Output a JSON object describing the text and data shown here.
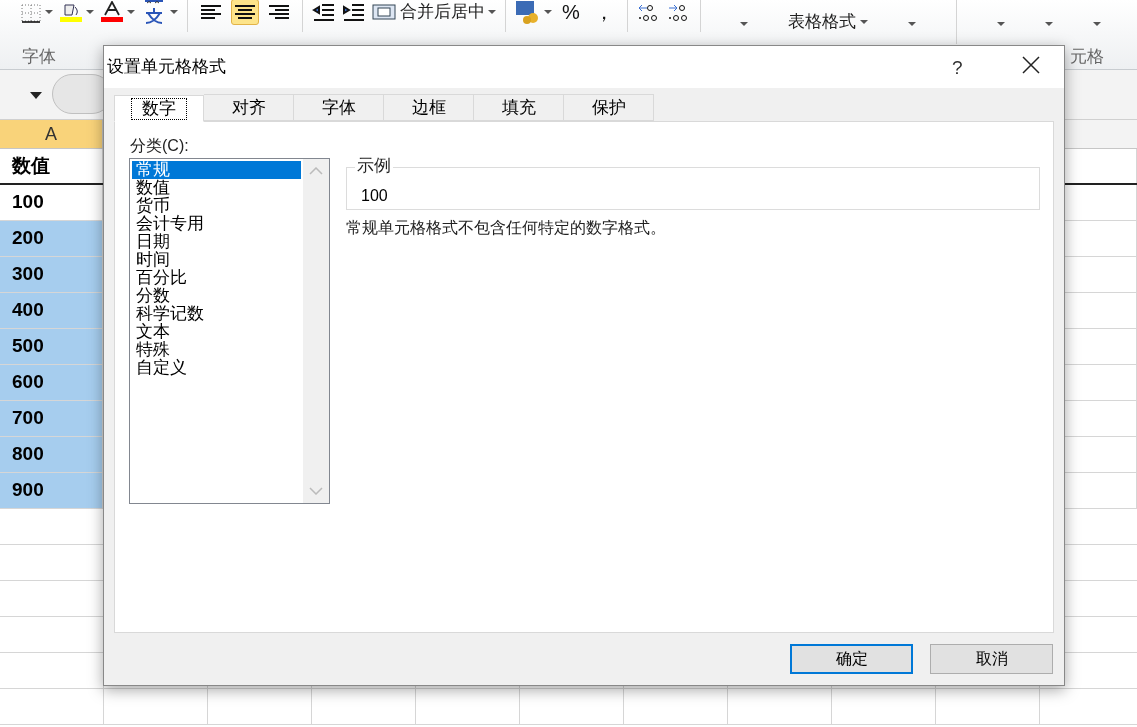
{
  "ribbon": {
    "tools": [
      {
        "kind": "borders"
      },
      {
        "kind": "fill"
      },
      {
        "kind": "fontcolor"
      },
      {
        "kind": "phonetic"
      },
      {
        "kind": "sep"
      },
      {
        "kind": "alignleft",
        "selected": false
      },
      {
        "kind": "aligncenter",
        "selected": true
      },
      {
        "kind": "alignright",
        "selected": false
      },
      {
        "kind": "sep"
      },
      {
        "kind": "outdent"
      },
      {
        "kind": "indent"
      },
      {
        "kind": "merge",
        "label": "合并后居中"
      },
      {
        "kind": "sep"
      },
      {
        "kind": "currency"
      },
      {
        "kind": "char",
        "label": "%"
      },
      {
        "kind": "char",
        "label": "，"
      },
      {
        "kind": "sep"
      },
      {
        "kind": "incdec"
      },
      {
        "kind": "decdec"
      },
      {
        "kind": "sep"
      }
    ],
    "big_buttons": [
      {
        "kind": "button"
      },
      {
        "kind": "button",
        "label": "表格格式"
      },
      {
        "kind": "button"
      },
      {
        "kind": "sep"
      },
      {
        "kind": "button"
      },
      {
        "kind": "button"
      },
      {
        "kind": "button"
      }
    ],
    "group_labels": [
      {
        "label": "字体"
      },
      {
        "label": "元格"
      }
    ]
  },
  "sheet": {
    "column_header": "A",
    "rows": [
      {
        "value": "数值",
        "kind": "header",
        "selected": false
      },
      {
        "value": "100",
        "kind": "cell",
        "selected": false
      },
      {
        "value": "200",
        "kind": "cell",
        "selected": true
      },
      {
        "value": "300",
        "kind": "cell",
        "selected": true
      },
      {
        "value": "400",
        "kind": "cell",
        "selected": true
      },
      {
        "value": "500",
        "kind": "cell",
        "selected": true
      },
      {
        "value": "600",
        "kind": "cell",
        "selected": true
      },
      {
        "value": "700",
        "kind": "cell",
        "selected": true
      },
      {
        "value": "800",
        "kind": "cell",
        "selected": true
      },
      {
        "value": "900",
        "kind": "cell",
        "selected": true
      }
    ]
  },
  "dialog": {
    "title": "设置单元格格式",
    "help": "?",
    "tabs": [
      {
        "label": "数字",
        "selected": true
      },
      {
        "label": "对齐",
        "selected": false
      },
      {
        "label": "字体",
        "selected": false
      },
      {
        "label": "边框",
        "selected": false
      },
      {
        "label": "填充",
        "selected": false
      },
      {
        "label": "保护",
        "selected": false
      }
    ],
    "category_label": "分类(C):",
    "categories": [
      {
        "label": "常规",
        "selected": true
      },
      {
        "label": "数值",
        "selected": false
      },
      {
        "label": "货币",
        "selected": false
      },
      {
        "label": "会计专用",
        "selected": false
      },
      {
        "label": "日期",
        "selected": false
      },
      {
        "label": "时间",
        "selected": false
      },
      {
        "label": "百分比",
        "selected": false
      },
      {
        "label": "分数",
        "selected": false
      },
      {
        "label": "科学记数",
        "selected": false
      },
      {
        "label": "文本",
        "selected": false
      },
      {
        "label": "特殊",
        "selected": false
      },
      {
        "label": "自定义",
        "selected": false
      }
    ],
    "sample": {
      "legend": "示例",
      "value": "100"
    },
    "description": "常规单元格格式不包含任何特定的数字格式。",
    "buttons": [
      {
        "label": "确定",
        "default": true
      },
      {
        "label": "取消",
        "default": false
      }
    ]
  }
}
